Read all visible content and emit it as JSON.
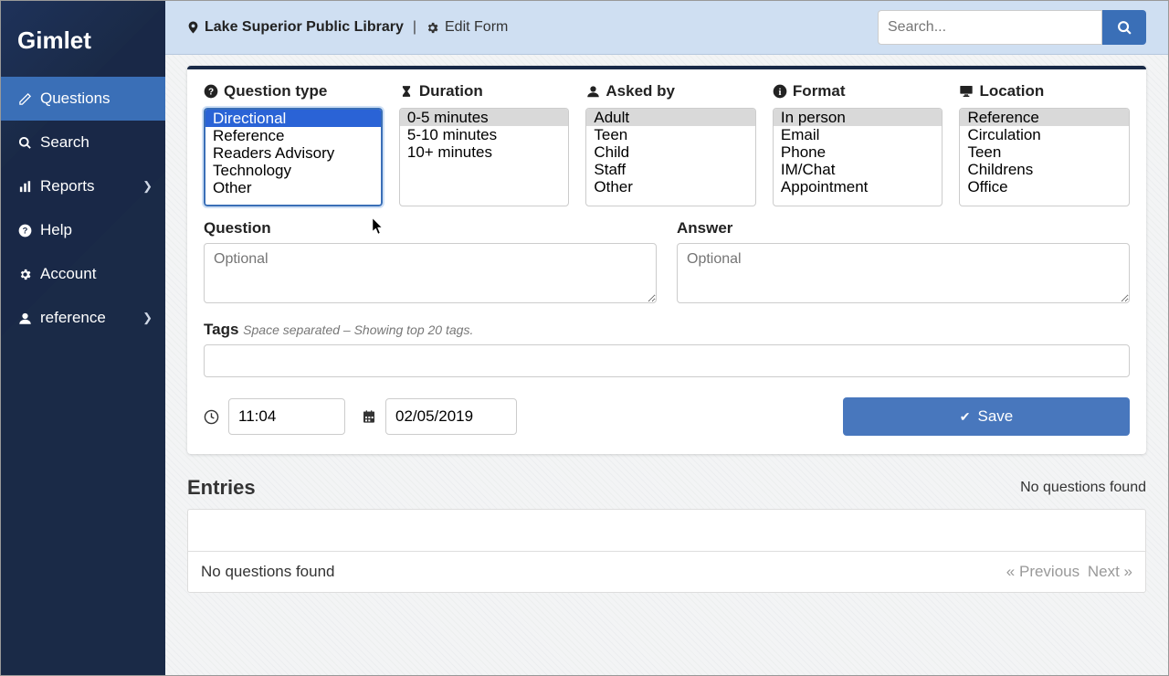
{
  "brand": "Gimlet",
  "sidebar": {
    "items": [
      {
        "label": "Questions",
        "icon": "edit-icon",
        "active": true
      },
      {
        "label": "Search",
        "icon": "search-icon"
      },
      {
        "label": "Reports",
        "icon": "bar-chart-icon",
        "chevron": true
      },
      {
        "label": "Help",
        "icon": "question-circle-icon"
      },
      {
        "label": "Account",
        "icon": "gear-icon"
      },
      {
        "label": "reference",
        "icon": "user-icon",
        "chevron": true
      }
    ]
  },
  "header": {
    "branch": "Lake Superior Public Library",
    "edit_form": "Edit Form",
    "search_placeholder": "Search..."
  },
  "form": {
    "columns": [
      {
        "label": "Question type",
        "icon": "question-circle",
        "options": [
          "Directional",
          "Reference",
          "Readers Advisory",
          "Technology",
          "Other"
        ],
        "selected": 0,
        "focused": true
      },
      {
        "label": "Duration",
        "icon": "hourglass",
        "options": [
          "0-5 minutes",
          "5-10 minutes",
          "10+ minutes"
        ],
        "selected": 0
      },
      {
        "label": "Asked by",
        "icon": "user",
        "options": [
          "Adult",
          "Teen",
          "Child",
          "Staff",
          "Other"
        ],
        "selected": 0
      },
      {
        "label": "Format",
        "icon": "info-circle",
        "options": [
          "In person",
          "Email",
          "Phone",
          "IM/Chat",
          "Appointment"
        ],
        "selected": 0
      },
      {
        "label": "Location",
        "icon": "monitor",
        "options": [
          "Reference",
          "Circulation",
          "Teen",
          "Childrens",
          "Office"
        ],
        "selected": 0
      }
    ],
    "question_label": "Question",
    "answer_label": "Answer",
    "optional_placeholder": "Optional",
    "tags_label": "Tags",
    "tags_hint": "Space separated – Showing top 20 tags.",
    "time_value": "11:04",
    "date_value": "02/05/2019",
    "save_label": "Save"
  },
  "entries": {
    "title": "Entries",
    "summary": "No questions found",
    "empty": "No questions found",
    "prev": "« Previous",
    "next": "Next »"
  }
}
